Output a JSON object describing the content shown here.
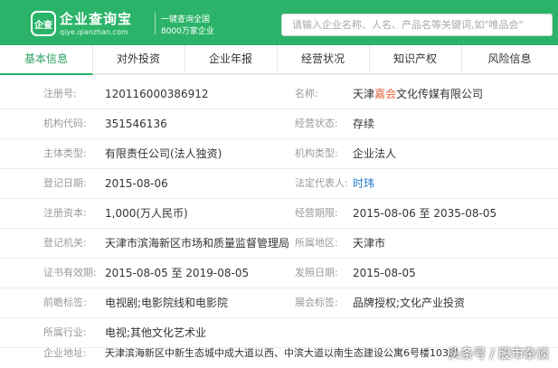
{
  "header": {
    "logo_glyph": "企查",
    "brand_name": "企业查询宝",
    "brand_domain": "qiye.qianzhan.com",
    "slogan_line1": "一键查询全国",
    "slogan_line2": "8000万家企业",
    "search_placeholder": "请输入企业名称、人名、产品名等关键词,如\"唯品会\""
  },
  "tabs": [
    "基本信息",
    "对外投资",
    "企业年报",
    "经营状况",
    "知识产权",
    "风险信息"
  ],
  "rows": [
    {
      "l1": "注册号:",
      "v1": "120116000386912",
      "l2": "名称:",
      "v2_pre": "天津",
      "v2_hl": "嘉会",
      "v2_post": "文化传媒有限公司"
    },
    {
      "l1": "机构代码:",
      "v1": "351546136",
      "l2": "经营状态:",
      "v2": "存续"
    },
    {
      "l1": "主体类型:",
      "v1": "有限责任公司(法人独资)",
      "l2": "机构类型:",
      "v2": "企业法人"
    },
    {
      "l1": "登记日期:",
      "v1": "2015-08-06",
      "l2": "法定代表人:",
      "v2": "时玮"
    },
    {
      "l1": "注册资本:",
      "v1": "1,000(万人民币)",
      "l2": "经营期限:",
      "v2": "2015-08-06 至 2035-08-05"
    },
    {
      "l1": "登记机关:",
      "v1": "天津市滨海新区市场和质量监督管理局",
      "l2": "所属地区:",
      "v2": "天津市"
    },
    {
      "l1": "证书有效期:",
      "v1": "2015-08-05 至 2019-08-05",
      "l2": "发照日期:",
      "v2": "2015-08-05"
    },
    {
      "l1": "前瞻标签:",
      "v1": "电视剧;电影院线和电影院",
      "l2": "展会标签:",
      "v2": "品牌授权;文化产业投资"
    },
    {
      "l1": "所属行业:",
      "v1": "电视;其他文化艺术业"
    },
    {
      "l1": "企业地址:",
      "v1": "天津滨海新区中新生态城中成大道以西、中滨大道以南生态建设公寓6号楼103房"
    }
  ],
  "watermark": "头条号 / 股市杂谈",
  "colors": {
    "brand_green": "#2bb469",
    "highlight": "#e0643a",
    "link": "#1e78c8"
  }
}
